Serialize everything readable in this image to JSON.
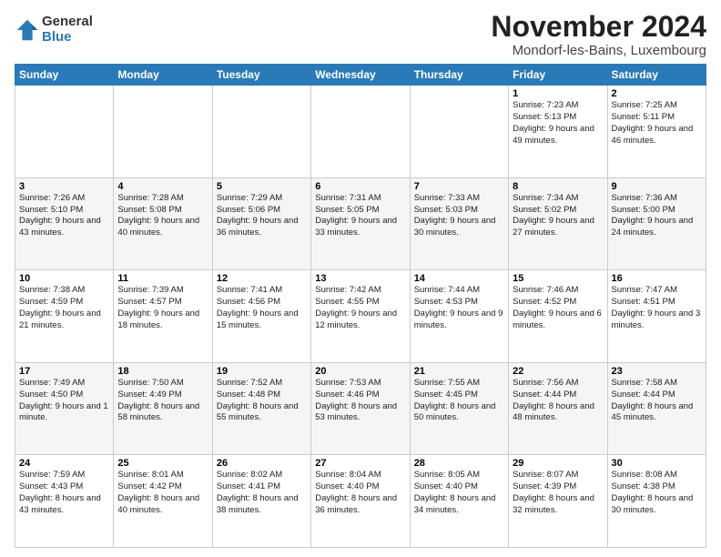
{
  "logo": {
    "general": "General",
    "blue": "Blue"
  },
  "title": "November 2024",
  "location": "Mondorf-les-Bains, Luxembourg",
  "days_of_week": [
    "Sunday",
    "Monday",
    "Tuesday",
    "Wednesday",
    "Thursday",
    "Friday",
    "Saturday"
  ],
  "weeks": [
    {
      "days": [
        {
          "num": "",
          "info": ""
        },
        {
          "num": "",
          "info": ""
        },
        {
          "num": "",
          "info": ""
        },
        {
          "num": "",
          "info": ""
        },
        {
          "num": "",
          "info": ""
        },
        {
          "num": "1",
          "info": "Sunrise: 7:23 AM\nSunset: 5:13 PM\nDaylight: 9 hours and 49 minutes."
        },
        {
          "num": "2",
          "info": "Sunrise: 7:25 AM\nSunset: 5:11 PM\nDaylight: 9 hours and 46 minutes."
        }
      ]
    },
    {
      "days": [
        {
          "num": "3",
          "info": "Sunrise: 7:26 AM\nSunset: 5:10 PM\nDaylight: 9 hours and 43 minutes."
        },
        {
          "num": "4",
          "info": "Sunrise: 7:28 AM\nSunset: 5:08 PM\nDaylight: 9 hours and 40 minutes."
        },
        {
          "num": "5",
          "info": "Sunrise: 7:29 AM\nSunset: 5:06 PM\nDaylight: 9 hours and 36 minutes."
        },
        {
          "num": "6",
          "info": "Sunrise: 7:31 AM\nSunset: 5:05 PM\nDaylight: 9 hours and 33 minutes."
        },
        {
          "num": "7",
          "info": "Sunrise: 7:33 AM\nSunset: 5:03 PM\nDaylight: 9 hours and 30 minutes."
        },
        {
          "num": "8",
          "info": "Sunrise: 7:34 AM\nSunset: 5:02 PM\nDaylight: 9 hours and 27 minutes."
        },
        {
          "num": "9",
          "info": "Sunrise: 7:36 AM\nSunset: 5:00 PM\nDaylight: 9 hours and 24 minutes."
        }
      ]
    },
    {
      "days": [
        {
          "num": "10",
          "info": "Sunrise: 7:38 AM\nSunset: 4:59 PM\nDaylight: 9 hours and 21 minutes."
        },
        {
          "num": "11",
          "info": "Sunrise: 7:39 AM\nSunset: 4:57 PM\nDaylight: 9 hours and 18 minutes."
        },
        {
          "num": "12",
          "info": "Sunrise: 7:41 AM\nSunset: 4:56 PM\nDaylight: 9 hours and 15 minutes."
        },
        {
          "num": "13",
          "info": "Sunrise: 7:42 AM\nSunset: 4:55 PM\nDaylight: 9 hours and 12 minutes."
        },
        {
          "num": "14",
          "info": "Sunrise: 7:44 AM\nSunset: 4:53 PM\nDaylight: 9 hours and 9 minutes."
        },
        {
          "num": "15",
          "info": "Sunrise: 7:46 AM\nSunset: 4:52 PM\nDaylight: 9 hours and 6 minutes."
        },
        {
          "num": "16",
          "info": "Sunrise: 7:47 AM\nSunset: 4:51 PM\nDaylight: 9 hours and 3 minutes."
        }
      ]
    },
    {
      "days": [
        {
          "num": "17",
          "info": "Sunrise: 7:49 AM\nSunset: 4:50 PM\nDaylight: 9 hours and 1 minute."
        },
        {
          "num": "18",
          "info": "Sunrise: 7:50 AM\nSunset: 4:49 PM\nDaylight: 8 hours and 58 minutes."
        },
        {
          "num": "19",
          "info": "Sunrise: 7:52 AM\nSunset: 4:48 PM\nDaylight: 8 hours and 55 minutes."
        },
        {
          "num": "20",
          "info": "Sunrise: 7:53 AM\nSunset: 4:46 PM\nDaylight: 8 hours and 53 minutes."
        },
        {
          "num": "21",
          "info": "Sunrise: 7:55 AM\nSunset: 4:45 PM\nDaylight: 8 hours and 50 minutes."
        },
        {
          "num": "22",
          "info": "Sunrise: 7:56 AM\nSunset: 4:44 PM\nDaylight: 8 hours and 48 minutes."
        },
        {
          "num": "23",
          "info": "Sunrise: 7:58 AM\nSunset: 4:44 PM\nDaylight: 8 hours and 45 minutes."
        }
      ]
    },
    {
      "days": [
        {
          "num": "24",
          "info": "Sunrise: 7:59 AM\nSunset: 4:43 PM\nDaylight: 8 hours and 43 minutes."
        },
        {
          "num": "25",
          "info": "Sunrise: 8:01 AM\nSunset: 4:42 PM\nDaylight: 8 hours and 40 minutes."
        },
        {
          "num": "26",
          "info": "Sunrise: 8:02 AM\nSunset: 4:41 PM\nDaylight: 8 hours and 38 minutes."
        },
        {
          "num": "27",
          "info": "Sunrise: 8:04 AM\nSunset: 4:40 PM\nDaylight: 8 hours and 36 minutes."
        },
        {
          "num": "28",
          "info": "Sunrise: 8:05 AM\nSunset: 4:40 PM\nDaylight: 8 hours and 34 minutes."
        },
        {
          "num": "29",
          "info": "Sunrise: 8:07 AM\nSunset: 4:39 PM\nDaylight: 8 hours and 32 minutes."
        },
        {
          "num": "30",
          "info": "Sunrise: 8:08 AM\nSunset: 4:38 PM\nDaylight: 8 hours and 30 minutes."
        }
      ]
    }
  ]
}
